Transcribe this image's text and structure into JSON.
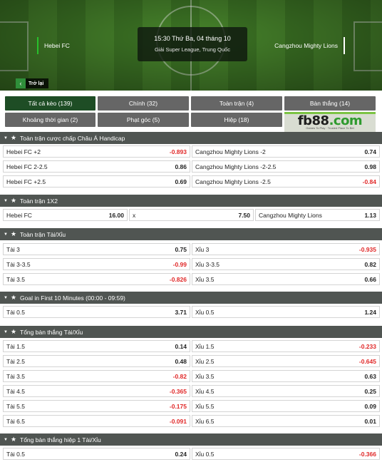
{
  "match": {
    "home": "Hebei FC",
    "away": "Cangzhou Mighty Lions",
    "time": "15:30 Thứ Ba, 04 tháng 10",
    "league": "Giải Super League, Trung Quốc",
    "back_label": "Trở lại"
  },
  "tabs": [
    {
      "label": "Tất cả kèo (139)"
    },
    {
      "label": "Chính (32)"
    },
    {
      "label": "Toàn trận (4)"
    },
    {
      "label": "Bàn thắng (14)"
    },
    {
      "label": "Khoảng thời gian (2)"
    },
    {
      "label": "Phạt góc (5)"
    },
    {
      "label": "Hiệp (18)"
    }
  ],
  "ad": {
    "brand_a": "fb88",
    "brand_b": ".com",
    "tagline": "Games To Play · Trusted Place To Bet"
  },
  "colors": {
    "accent": "#1e4d25",
    "negative": "#e02828",
    "header": "#505552"
  },
  "sections": [
    {
      "title": "Toàn trận cược chấp Châu Á Handicap",
      "rows": [
        [
          {
            "label": "Hebei FC +2",
            "odd": "-0.893"
          },
          {
            "label": "Cangzhou Mighty Lions -2",
            "odd": "0.74"
          }
        ],
        [
          {
            "label": "Hebei FC 2-2.5",
            "odd": "0.86"
          },
          {
            "label": "Cangzhou Mighty Lions -2-2.5",
            "odd": "0.98"
          }
        ],
        [
          {
            "label": "Hebei FC +2.5",
            "odd": "0.69"
          },
          {
            "label": "Cangzhou Mighty Lions -2.5",
            "odd": "-0.84"
          }
        ]
      ]
    },
    {
      "title": "Toàn trận 1X2",
      "rows": [
        [
          {
            "label": "Hebei FC",
            "odd": "16.00"
          },
          {
            "label": "x",
            "odd": "7.50"
          },
          {
            "label": "Cangzhou Mighty Lions",
            "odd": "1.13"
          }
        ]
      ]
    },
    {
      "title": "Toàn trận Tài/Xỉu",
      "rows": [
        [
          {
            "label": "Tài 3",
            "odd": "0.75"
          },
          {
            "label": "Xỉu 3",
            "odd": "-0.935"
          }
        ],
        [
          {
            "label": "Tài 3-3.5",
            "odd": "-0.99"
          },
          {
            "label": "Xỉu 3-3.5",
            "odd": "0.82"
          }
        ],
        [
          {
            "label": "Tài 3.5",
            "odd": "-0.826"
          },
          {
            "label": "Xỉu 3.5",
            "odd": "0.66"
          }
        ]
      ]
    },
    {
      "title": "Goal in First 10 Minutes (00:00 - 09:59)",
      "rows": [
        [
          {
            "label": "Tài 0.5",
            "odd": "3.71"
          },
          {
            "label": "Xỉu 0.5",
            "odd": "1.24"
          }
        ]
      ]
    },
    {
      "title": "Tổng bàn thắng Tài/Xỉu",
      "rows": [
        [
          {
            "label": "Tài 1.5",
            "odd": "0.14"
          },
          {
            "label": "Xỉu 1.5",
            "odd": "-0.233"
          }
        ],
        [
          {
            "label": "Tài 2.5",
            "odd": "0.48"
          },
          {
            "label": "Xỉu 2.5",
            "odd": "-0.645"
          }
        ],
        [
          {
            "label": "Tài 3.5",
            "odd": "-0.82"
          },
          {
            "label": "Xỉu 3.5",
            "odd": "0.63"
          }
        ],
        [
          {
            "label": "Tài 4.5",
            "odd": "-0.365"
          },
          {
            "label": "Xỉu 4.5",
            "odd": "0.25"
          }
        ],
        [
          {
            "label": "Tài 5.5",
            "odd": "-0.175"
          },
          {
            "label": "Xỉu 5.5",
            "odd": "0.09"
          }
        ],
        [
          {
            "label": "Tài 6.5",
            "odd": "-0.091"
          },
          {
            "label": "Xỉu 6.5",
            "odd": "0.01"
          }
        ]
      ]
    },
    {
      "title": "Tổng bàn thắng hiệp 1 Tài/Xỉu",
      "rows": [
        [
          {
            "label": "Tài 0.5",
            "odd": "0.24"
          },
          {
            "label": "Xỉu 0.5",
            "odd": "-0.366"
          }
        ]
      ]
    }
  ]
}
